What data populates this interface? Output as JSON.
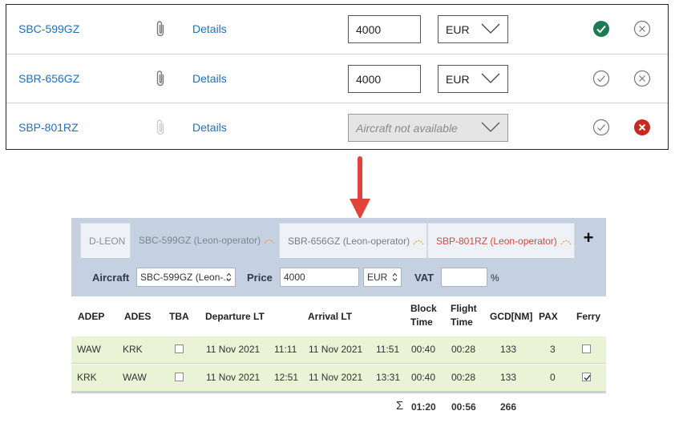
{
  "quotes": [
    {
      "registration": "SBC-599GZ",
      "details_label": "Details",
      "price": "4000",
      "currency": "EUR",
      "available": true,
      "accepted": true,
      "rejected": false
    },
    {
      "registration": "SBR-656GZ",
      "details_label": "Details",
      "price": "4000",
      "currency": "EUR",
      "available": true,
      "accepted": false,
      "rejected": false
    },
    {
      "registration": "SBP-801RZ",
      "details_label": "Details",
      "price": "",
      "currency": "",
      "available": false,
      "unavailable_text": "Aircraft not available",
      "accepted": false,
      "rejected": true
    }
  ],
  "tabs": [
    {
      "label": "D-LEON"
    },
    {
      "label": "SBC-599GZ (Leon-operator)"
    },
    {
      "label": "SBR-656GZ (Leon-operator)"
    },
    {
      "label": "SBP-801RZ (Leon-operator)"
    }
  ],
  "add_tab_label": "+",
  "filters": {
    "aircraft_label": "Aircraft",
    "aircraft_value": "SBC-599GZ (Leon-...",
    "price_label": "Price",
    "price_value": "4000",
    "currency_value": "EUR",
    "vat_label": "VAT",
    "vat_value": "",
    "percent_label": "%"
  },
  "columns": {
    "adep": "ADEP",
    "ades": "ADES",
    "tba": "TBA",
    "departure": "Departure LT",
    "arrival": "Arrival LT",
    "block_time_1": "Block",
    "block_time_2": "Time",
    "flight_time_1": "Flight",
    "flight_time_2": "Time",
    "gcd": "GCD[NM]",
    "pax": "PAX",
    "ferry": "Ferry"
  },
  "legs": [
    {
      "adep": "WAW",
      "ades": "KRK",
      "tba": false,
      "dep_date": "11 Nov 2021",
      "dep_time": "11:11",
      "arr_date": "11 Nov 2021",
      "arr_time": "11:51",
      "block": "00:40",
      "flight": "00:28",
      "gcd": "133",
      "pax": "3",
      "ferry": false
    },
    {
      "adep": "KRK",
      "ades": "WAW",
      "tba": false,
      "dep_date": "11 Nov 2021",
      "dep_time": "12:51",
      "arr_date": "11 Nov 2021",
      "arr_time": "13:31",
      "block": "00:40",
      "flight": "00:28",
      "gcd": "133",
      "pax": "0",
      "ferry": true
    }
  ],
  "totals": {
    "sigma": "Σ",
    "block": "01:20",
    "flight": "00:56",
    "gcd": "266"
  },
  "colors": {
    "link": "#1f6fbf",
    "accept_green": "#1e7a53",
    "reject_red": "#c8281e",
    "arrow_red": "#e0443a",
    "tab_bar": "#c5d1e0",
    "leg_row": "#eaf3d6"
  }
}
